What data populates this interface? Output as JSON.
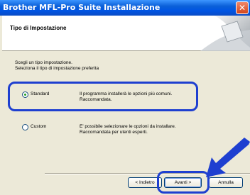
{
  "window": {
    "title": "Brother MFL-Pro Suite Installazione",
    "close_glyph": "✕"
  },
  "header": {
    "title": "Tipo di Impostazione"
  },
  "instructions": {
    "line1": "Scegli un tipo  impostazione.",
    "line2": "Seleziona il tipo di impostazione preferita"
  },
  "options": [
    {
      "label": "Standard",
      "selected": true,
      "desc_line1": "Il programma installerà le opzioni più comuni.",
      "desc_line2": "Raccomandata."
    },
    {
      "label": "Custom",
      "selected": false,
      "desc_line1": "E' possibile selezionare le opzioni da installare.",
      "desc_line2": "Raccomandata per utenti esperti."
    }
  ],
  "buttons": {
    "back": "< Indietro",
    "next": "Avanti >",
    "cancel": "Annulla"
  },
  "colors": {
    "annotation": "#1e3fd0",
    "titlebar": "#0054e3"
  }
}
